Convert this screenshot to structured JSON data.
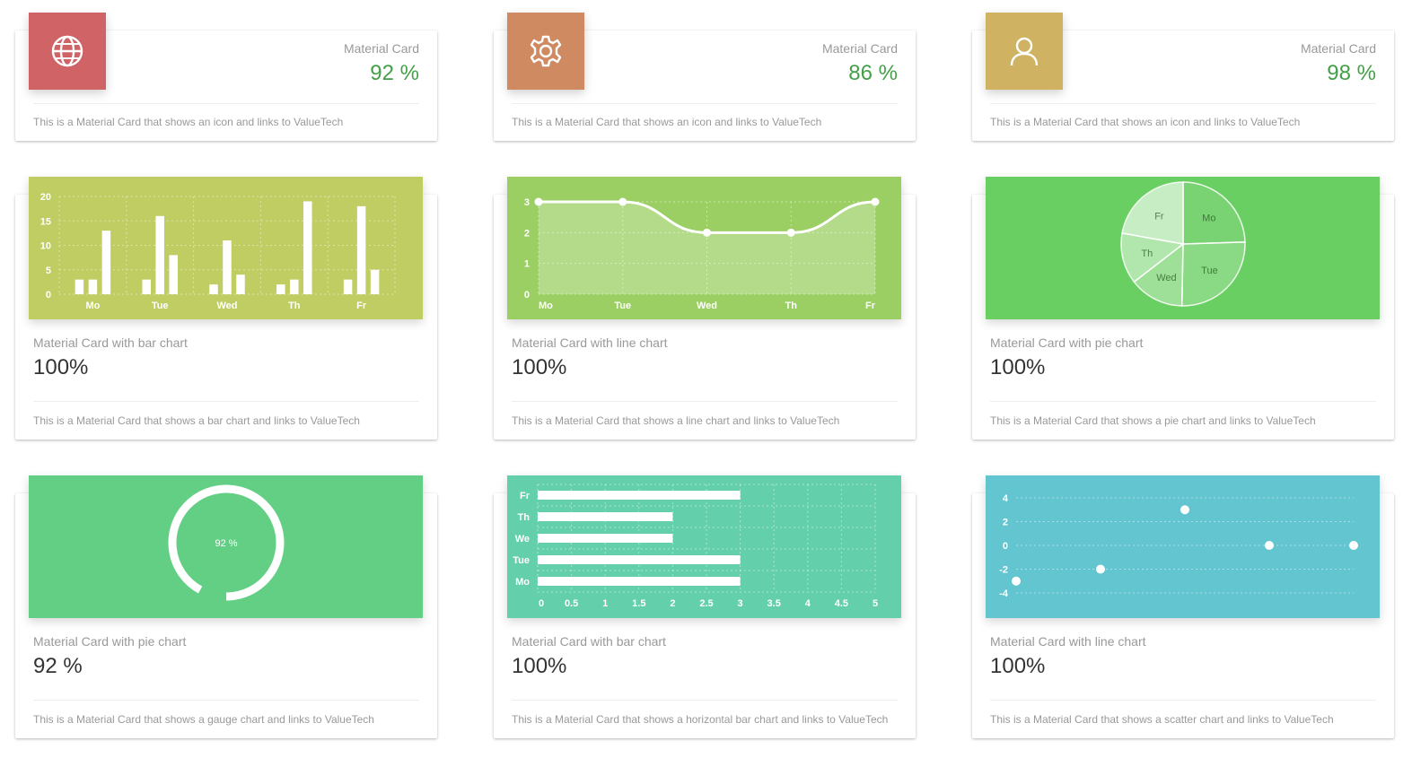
{
  "kpi_cards": [
    {
      "title": "Material Card",
      "value": "92 %",
      "footer": "This is a Material Card that shows an icon and links to ValueTech",
      "icon": "globe-icon",
      "color": "#cf6365"
    },
    {
      "title": "Material Card",
      "value": "86 %",
      "footer": "This is a Material Card that shows an icon and links to ValueTech",
      "icon": "gear-icon",
      "color": "#cf8a62"
    },
    {
      "title": "Material Card",
      "value": "98 %",
      "footer": "This is a Material Card that shows an icon and links to ValueTech",
      "icon": "user-icon",
      "color": "#cfb363"
    }
  ],
  "chart_cards": [
    {
      "title": "Material Card with bar chart",
      "value": "100%",
      "footer": "This is a Material Card that shows a bar chart and links to ValueTech",
      "color": "#bfcd63"
    },
    {
      "title": "Material Card with line chart",
      "value": "100%",
      "footer": "This is a Material Card that shows a line chart and links to ValueTech",
      "color": "#9bcf63"
    },
    {
      "title": "Material Card with pie chart",
      "value": "100%",
      "footer": "This is a Material Card that shows a pie chart and links to ValueTech",
      "color": "#6acf62"
    },
    {
      "title": "Material Card with pie chart",
      "value": "92 %",
      "footer": "This is a Material Card that shows a gauge chart and links to ValueTech",
      "color": "#63cf85"
    },
    {
      "title": "Material Card with bar chart",
      "value": "100%",
      "footer": "This is a Material Card that shows a horizontal bar chart and links to ValueTech",
      "color": "#63cfab"
    },
    {
      "title": "Material Card with line chart",
      "value": "100%",
      "footer": "This is a Material Card that shows a scatter chart and links to ValueTech",
      "color": "#63c5cf"
    }
  ],
  "chart_data": [
    {
      "type": "bar",
      "categories": [
        "Mo",
        "Tue",
        "Wed",
        "Th",
        "Fr"
      ],
      "series": [
        {
          "values": [
            3,
            3,
            2,
            2,
            3
          ]
        },
        {
          "values": [
            3,
            16,
            11,
            3,
            18
          ]
        },
        {
          "values": [
            13,
            8,
            4,
            19,
            5
          ]
        }
      ],
      "ylim": [
        0,
        20
      ],
      "yticks": [
        0,
        5,
        10,
        15,
        20
      ],
      "grid": true
    },
    {
      "type": "line",
      "categories": [
        "Mo",
        "Tue",
        "Wed",
        "Th",
        "Fr"
      ],
      "values": [
        3,
        3,
        2,
        2,
        3
      ],
      "ylim": [
        0,
        3
      ],
      "yticks": [
        0,
        1,
        2,
        3
      ],
      "grid": true
    },
    {
      "type": "pie",
      "categories": [
        "Mo",
        "Tue",
        "Wed",
        "Th",
        "Fr"
      ],
      "values": [
        24.5,
        25.8,
        14.2,
        13.3,
        22.2
      ],
      "unit": "percent of total"
    },
    {
      "type": "gauge",
      "value": 92,
      "label": "92 %",
      "max": 100
    },
    {
      "type": "bar",
      "orientation": "horizontal",
      "categories": [
        "Mo",
        "Tue",
        "We",
        "Th",
        "Fr"
      ],
      "values": [
        3,
        3,
        2,
        2,
        3
      ],
      "xlim": [
        0,
        5
      ],
      "xticks": [
        "0",
        "0.5",
        "1",
        "1.5",
        "2",
        "2.5",
        "3",
        "3.5",
        "4",
        "4.5",
        "5"
      ],
      "grid": true
    },
    {
      "type": "scatter",
      "x": [
        1,
        2,
        3,
        4,
        5
      ],
      "y": [
        -3,
        -2,
        3,
        0,
        0
      ],
      "ylim": [
        -4,
        4
      ],
      "yticks": [
        -4,
        -2,
        0,
        2,
        4
      ],
      "grid": true
    }
  ]
}
